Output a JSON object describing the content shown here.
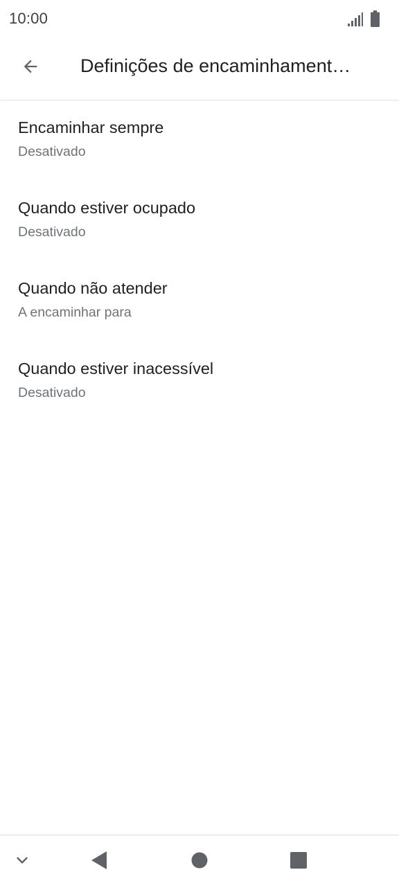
{
  "status_bar": {
    "time": "10:00",
    "icons": [
      "signal-icon",
      "battery-icon"
    ]
  },
  "app_bar": {
    "back_icon": "arrow-left-icon",
    "title": "Definições de encaminhament…"
  },
  "settings": {
    "items": [
      {
        "title": "Encaminhar sempre",
        "summary": "Desativado"
      },
      {
        "title": "Quando estiver ocupado",
        "summary": "Desativado"
      },
      {
        "title": "Quando não atender",
        "summary": "A encaminhar para"
      },
      {
        "title": "Quando estiver inacessível",
        "summary": "Desativado"
      }
    ]
  },
  "nav_bar": {
    "icons": [
      "chevron-down-icon",
      "triangle-back-icon",
      "circle-home-icon",
      "square-recents-icon"
    ]
  },
  "colors": {
    "icon_gray": "#5f6368",
    "title_text": "#202124",
    "summary_text": "#6f7276"
  }
}
